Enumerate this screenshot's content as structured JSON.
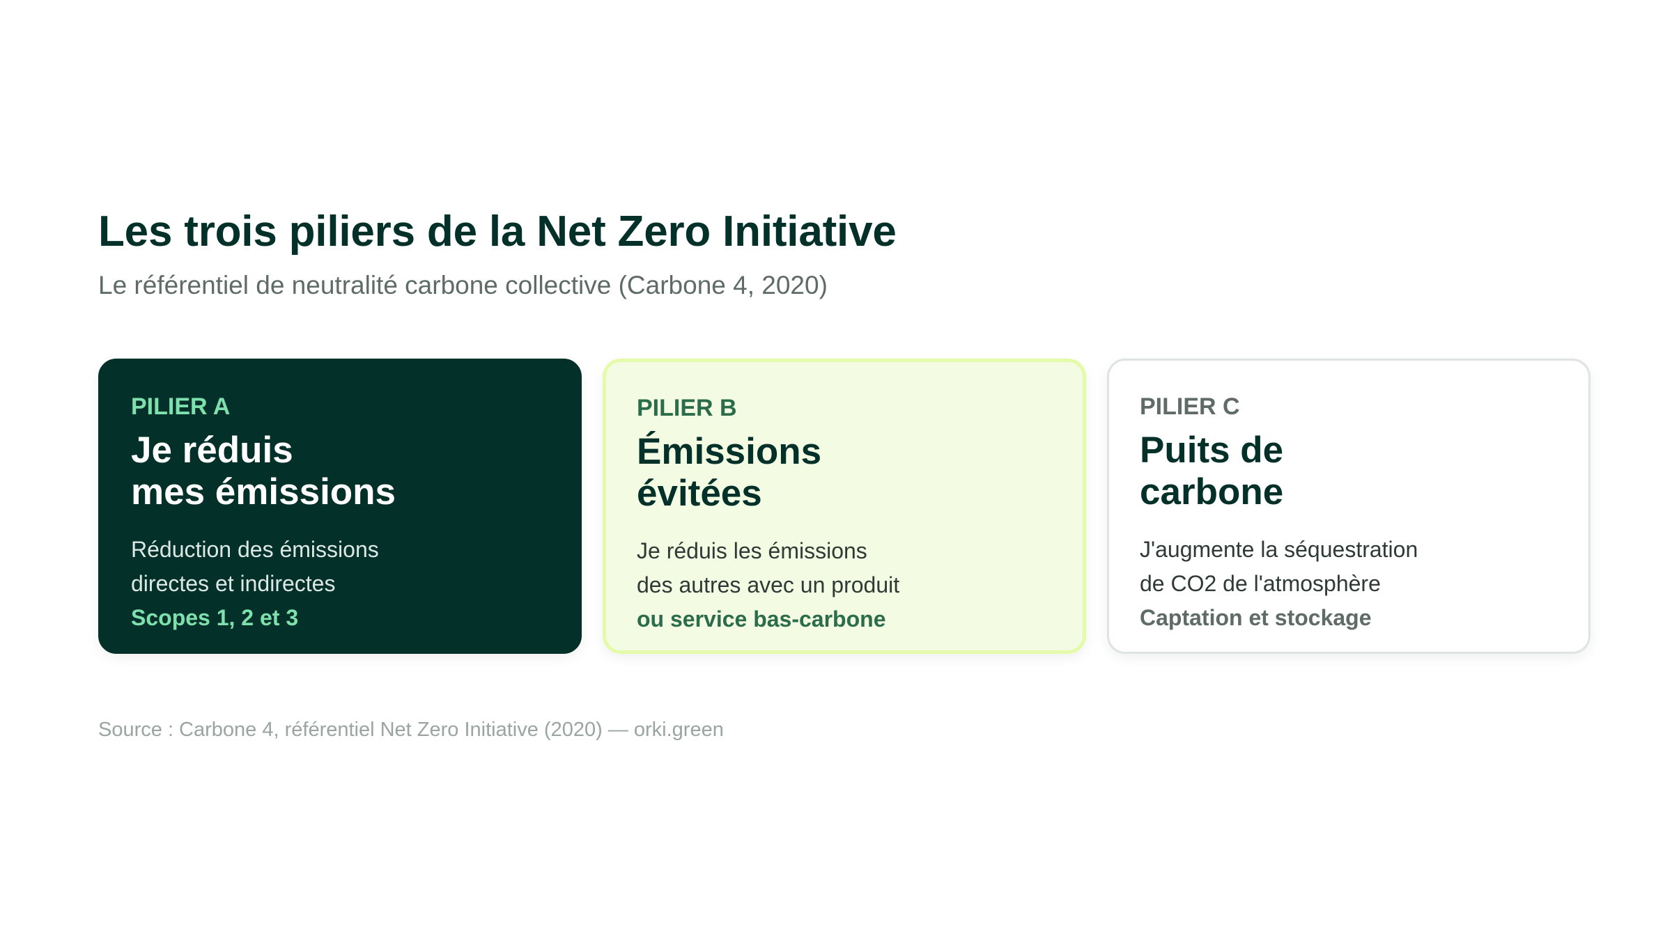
{
  "header": {
    "title": "Les trois piliers de la Net Zero Initiative",
    "subtitle": "Le référentiel de neutralité carbone collective (Carbone 4, 2020)"
  },
  "pillars": [
    {
      "label": "PILIER A",
      "title": "Je réduis\nmes émissions",
      "description": "Réduction des émissions\ndirectes et indirectes",
      "highlight": "Scopes 1, 2 et 3"
    },
    {
      "label": "PILIER B",
      "title": "Émissions\névitées",
      "description": "Je réduis les émissions\ndes autres avec un produit",
      "highlight": "ou service bas-carbone"
    },
    {
      "label": "PILIER C",
      "title": "Puits de\ncarbone",
      "description": "J'augmente la séquestration\nde CO2 de l'atmosphère",
      "highlight": "Captation et stockage"
    }
  ],
  "footer": {
    "source": "Source : Carbone 4, référentiel Net Zero Initiative (2020) — orki.green"
  },
  "colors": {
    "dark_green": "#04302a",
    "mint": "#7ee0ad",
    "medium_green": "#2b6d4a",
    "lime_border": "#e4fba9",
    "lime_bg": "#f3fbe3",
    "gray": "#5f6b67"
  }
}
